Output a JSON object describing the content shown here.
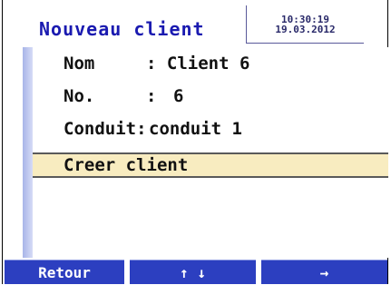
{
  "header": {
    "title": "Nouveau client",
    "time": "10:30:19",
    "date": "19.03.2012"
  },
  "fields": {
    "nom_label": "Nom",
    "nom_value": ": Client 6",
    "no_label": "No.",
    "no_sep": ":",
    "no_value": "6",
    "conduit_label": "Conduit:",
    "conduit_value": "conduit 1"
  },
  "menu": {
    "create_client": "Creer client"
  },
  "softkeys": {
    "back": "Retour",
    "updown": "↑ ↓",
    "next": "→"
  },
  "colors": {
    "title": "#1a1ab0",
    "softkey_bg": "#2c3fc0",
    "selection_bg": "#f8ecc0",
    "left_bar": "#a8b4e8"
  }
}
